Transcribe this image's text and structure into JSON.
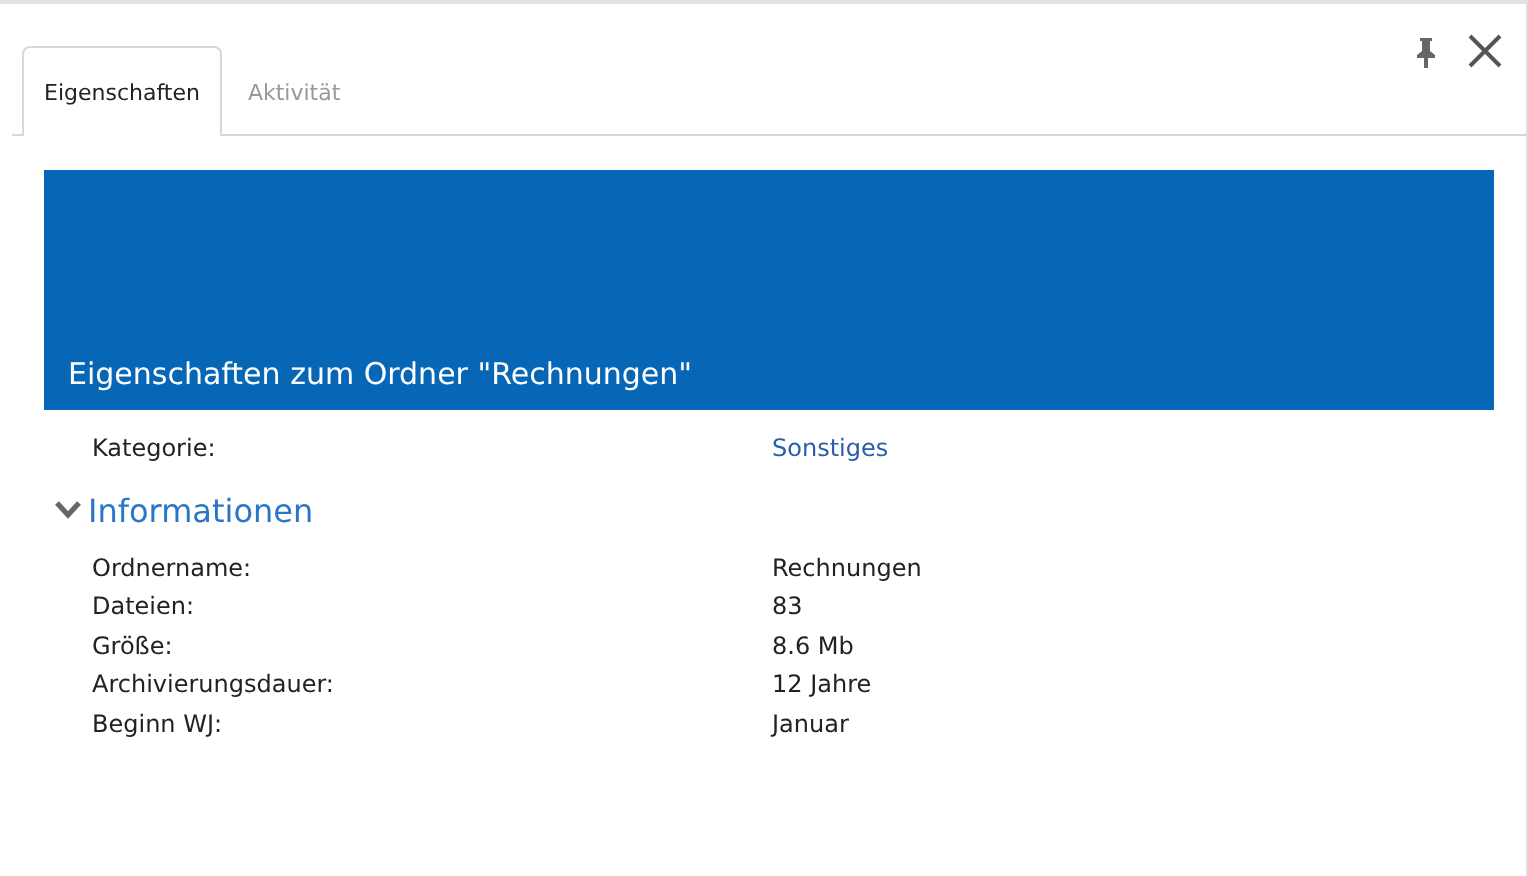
{
  "tabs": [
    {
      "label": "Eigenschaften",
      "selected": true
    },
    {
      "label": "Aktivität",
      "selected": false
    }
  ],
  "banner": {
    "title": "Eigenschaften zum Ordner \"Rechnungen\""
  },
  "category": {
    "label": "Kategorie:",
    "value": "Sonstiges"
  },
  "section": {
    "title": "Informationen",
    "expanded": true,
    "rows": [
      {
        "label": "Ordnername:",
        "value": "Rechnungen"
      },
      {
        "label": "Dateien:",
        "value": "83"
      },
      {
        "label": "Größe:",
        "value": "8.6 Mb"
      },
      {
        "label": "Archivierungsdauer:",
        "value": "12 Jahre"
      },
      {
        "label": "Beginn WJ:",
        "value": "Januar"
      }
    ]
  }
}
